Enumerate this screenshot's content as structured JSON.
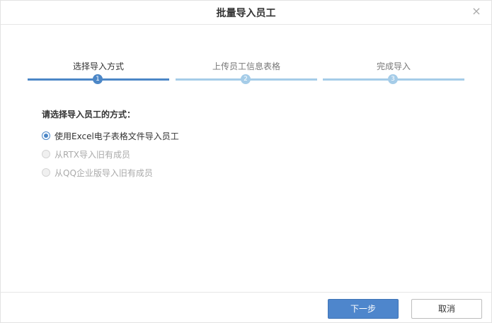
{
  "dialog": {
    "title": "批量导入员工",
    "close_symbol": "×"
  },
  "steps": [
    {
      "label": "选择导入方式",
      "number": "1",
      "state": "active"
    },
    {
      "label": "上传员工信息表格",
      "number": "2",
      "state": "inactive"
    },
    {
      "label": "完成导入",
      "number": "3",
      "state": "inactive"
    }
  ],
  "form": {
    "section_title": "请选择导入员工的方式：",
    "options": [
      {
        "label": "使用Excel电子表格文件导入员工",
        "selected": true,
        "disabled": false
      },
      {
        "label": "从RTX导入旧有成员",
        "selected": false,
        "disabled": true
      },
      {
        "label": "从QQ企业版导入旧有成员",
        "selected": false,
        "disabled": true
      }
    ]
  },
  "footer": {
    "next_label": "下一步",
    "cancel_label": "取消"
  },
  "colors": {
    "accent": "#4c87c7",
    "inactive_step": "#a5cce8",
    "primary_button": "#4e86cc"
  }
}
